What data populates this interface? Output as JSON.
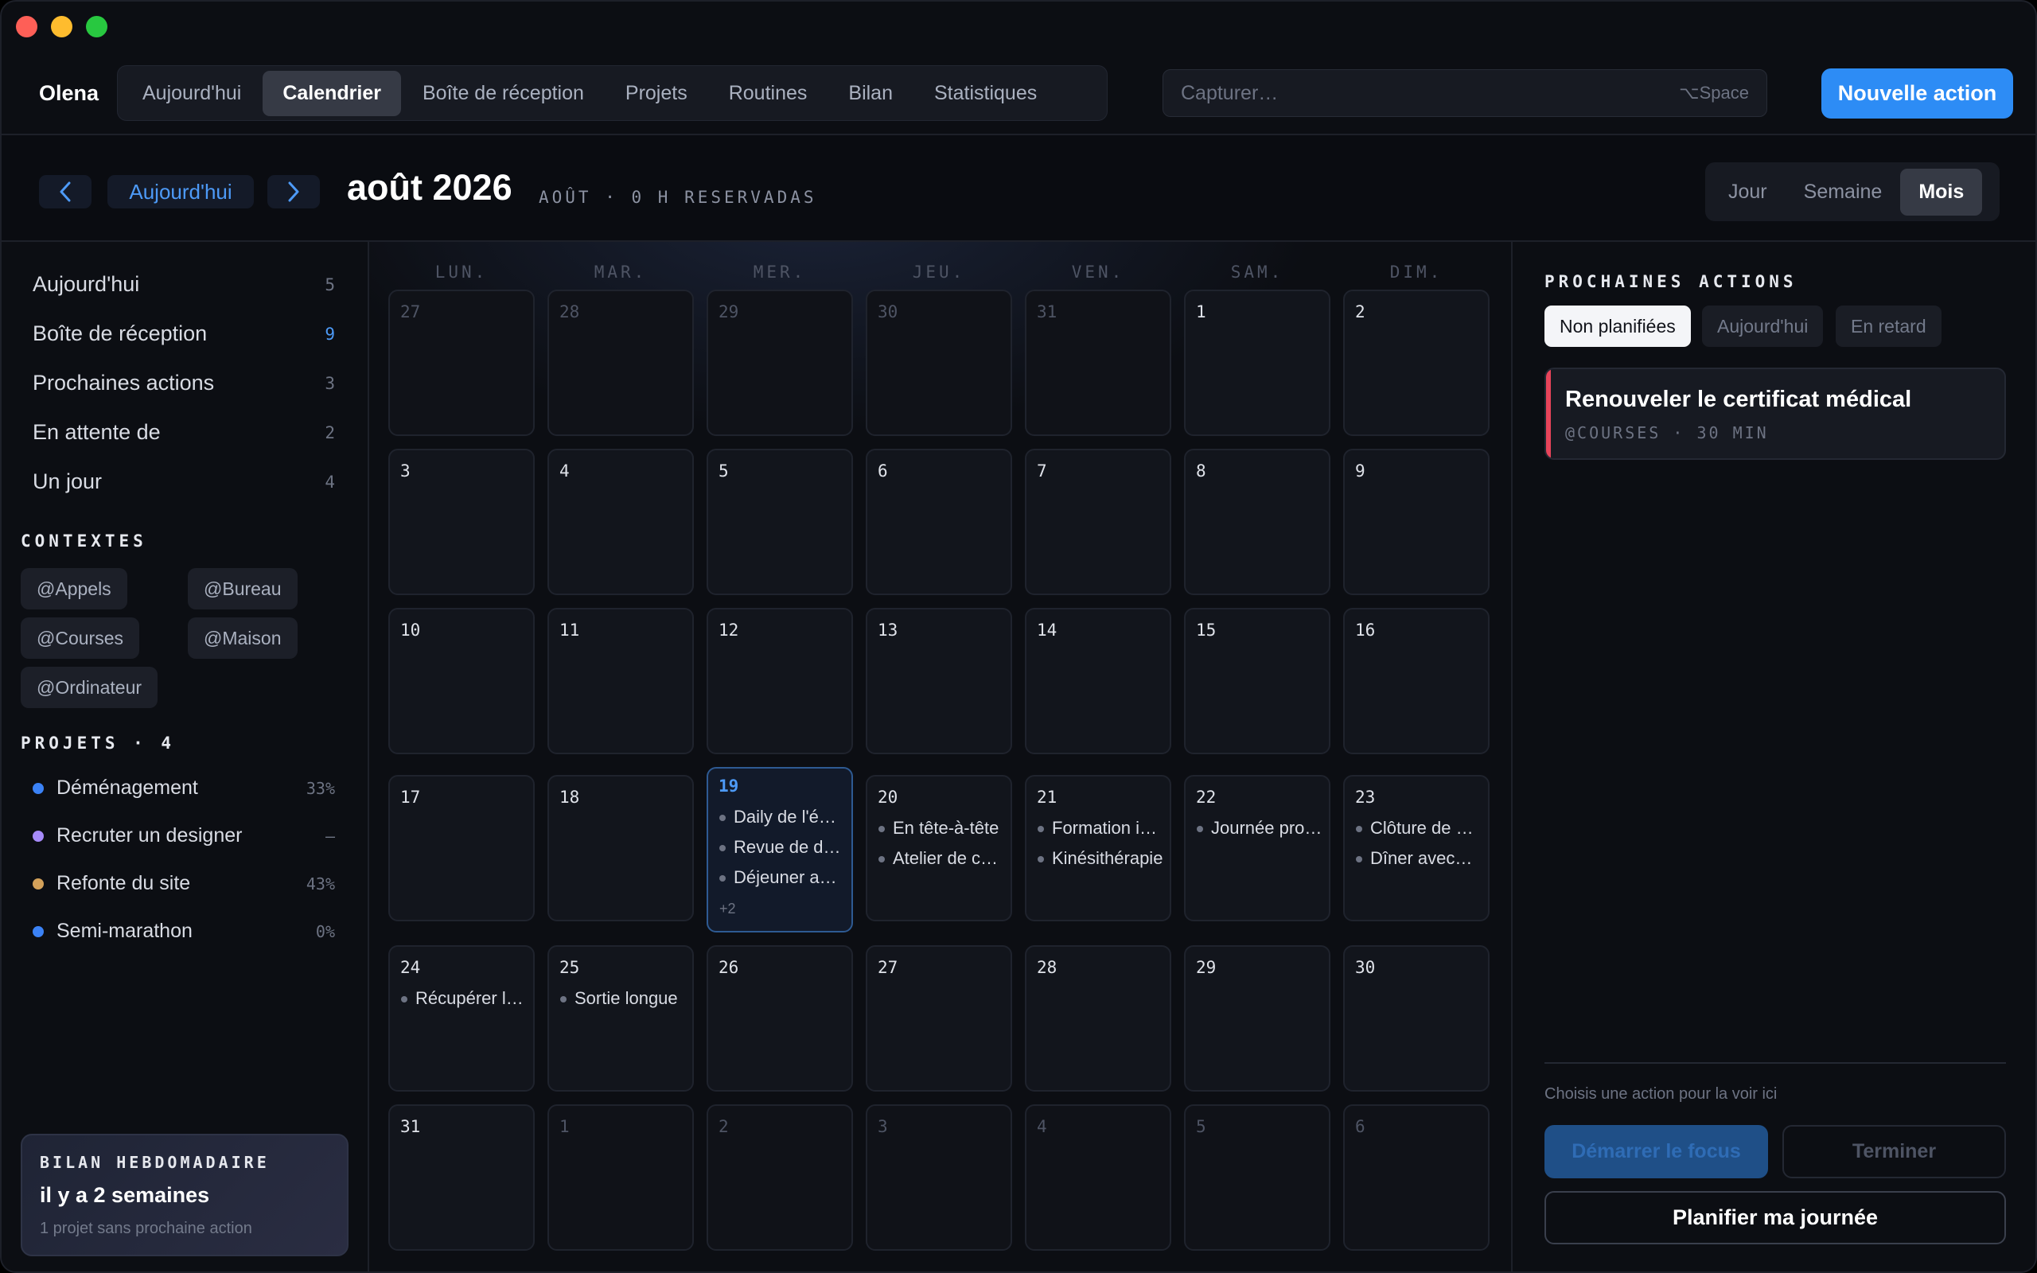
{
  "brand": "Olena",
  "nav": {
    "items": [
      "Aujourd'hui",
      "Calendrier",
      "Boîte de réception",
      "Projets",
      "Routines",
      "Bilan",
      "Statistiques"
    ],
    "active": "Calendrier"
  },
  "capture": {
    "placeholder": "Capturer…",
    "shortcut": "⌥Space"
  },
  "new_action_label": "Nouvelle action",
  "toolbar": {
    "prev_icon": "chevron-left-icon",
    "today_label": "Aujourd'hui",
    "next_icon": "chevron-right-icon",
    "month_title": "août 2026",
    "month_sub": "AOÛT · 0 H RESERVADAS",
    "views": [
      "Jour",
      "Semaine",
      "Mois"
    ],
    "active_view": "Mois"
  },
  "sidebar": {
    "lists": [
      {
        "label": "Aujourd'hui",
        "count": "5"
      },
      {
        "label": "Boîte de réception",
        "count": "9",
        "highlight": true
      },
      {
        "label": "Prochaines actions",
        "count": "3"
      },
      {
        "label": "En attente de",
        "count": "2"
      },
      {
        "label": "Un jour",
        "count": "4"
      }
    ],
    "contexts_title": "CONTEXTES",
    "contexts": [
      "@Appels",
      "@Bureau",
      "@Courses",
      "@Maison",
      "@Ordinateur"
    ],
    "projects_title": "PROJETS · 4",
    "projects": [
      {
        "label": "Déménagement",
        "pct": "33%",
        "color": "#3b82f6"
      },
      {
        "label": "Recruter un designer",
        "pct": "–",
        "color": "#a78bfa"
      },
      {
        "label": "Refonte du site",
        "pct": "43%",
        "color": "#d4a15a"
      },
      {
        "label": "Semi-marathon",
        "pct": "0%",
        "color": "#3b82f6"
      }
    ],
    "weekly": {
      "title": "BILAN HEBDOMADAIRE",
      "when": "il y a 2 semaines",
      "note": "1 projet sans prochaine action"
    }
  },
  "calendar": {
    "weekdays": [
      "LUN.",
      "MAR.",
      "MER.",
      "JEU.",
      "VEN.",
      "SAM.",
      "DIM."
    ],
    "weeks": [
      [
        {
          "d": "27",
          "other": true
        },
        {
          "d": "28",
          "other": true
        },
        {
          "d": "29",
          "other": true
        },
        {
          "d": "30",
          "other": true
        },
        {
          "d": "31",
          "other": true
        },
        {
          "d": "1"
        },
        {
          "d": "2"
        }
      ],
      [
        {
          "d": "3"
        },
        {
          "d": "4"
        },
        {
          "d": "5"
        },
        {
          "d": "6"
        },
        {
          "d": "7"
        },
        {
          "d": "8"
        },
        {
          "d": "9"
        }
      ],
      [
        {
          "d": "10"
        },
        {
          "d": "11"
        },
        {
          "d": "12"
        },
        {
          "d": "13"
        },
        {
          "d": "14"
        },
        {
          "d": "15"
        },
        {
          "d": "16"
        }
      ],
      [
        {
          "d": "17"
        },
        {
          "d": "18"
        },
        {
          "d": "19",
          "today": true,
          "events": [
            "Daily de l'équipe",
            "Revue de design",
            "Déjeuner avec"
          ],
          "more": "+2"
        },
        {
          "d": "20",
          "events": [
            "En tête-à-tête",
            "Atelier de c…"
          ]
        },
        {
          "d": "21",
          "events": [
            "Formation i…",
            "Kinésithérapie"
          ]
        },
        {
          "d": "22",
          "events": [
            "Journée produit"
          ]
        },
        {
          "d": "23",
          "events": [
            "Clôture de s…",
            "Dîner avec…"
          ]
        }
      ],
      [
        {
          "d": "24",
          "events": [
            "Récupérer l…"
          ]
        },
        {
          "d": "25",
          "events": [
            "Sortie longue"
          ]
        },
        {
          "d": "26"
        },
        {
          "d": "27"
        },
        {
          "d": "28"
        },
        {
          "d": "29"
        },
        {
          "d": "30"
        }
      ],
      [
        {
          "d": "31"
        },
        {
          "d": "1",
          "other": true
        },
        {
          "d": "2",
          "other": true
        },
        {
          "d": "3",
          "other": true
        },
        {
          "d": "4",
          "other": true
        },
        {
          "d": "5",
          "other": true
        },
        {
          "d": "6",
          "other": true
        }
      ]
    ]
  },
  "right": {
    "title": "PROCHAINES ACTIONS",
    "filters": [
      "Non planifiées",
      "Aujourd'hui",
      "En retard"
    ],
    "active_filter": "Non planifiées",
    "card": {
      "title": "Renouveler le certificat médical",
      "meta": "@COURSES · 30 MIN",
      "accent": "#e8445a"
    },
    "hint": "Choisis une action pour la voir ici",
    "focus_label": "Démarrer le focus",
    "finish_label": "Terminer",
    "plan_label": "Planifier ma journée"
  }
}
